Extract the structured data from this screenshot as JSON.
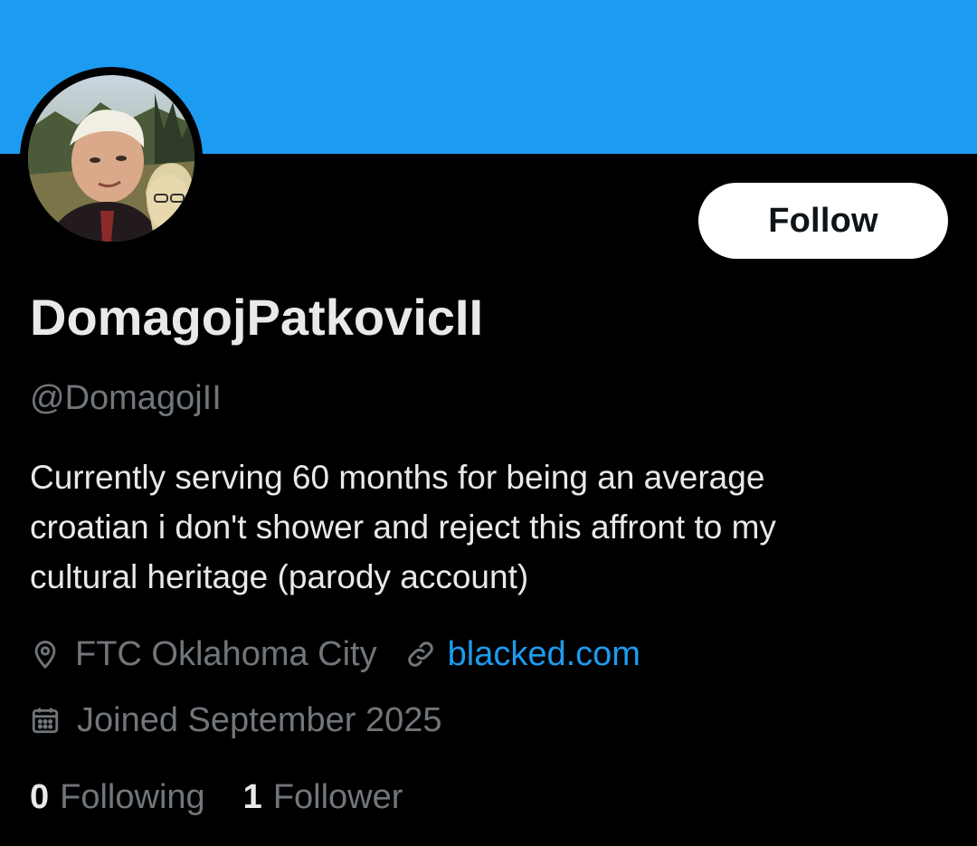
{
  "profile": {
    "banner_color": "#1d9bf0",
    "avatar_alt": "profile photo",
    "follow_label": "Follow",
    "display_name": "DomagojPatkovicII",
    "handle": "@DomagojII",
    "bio": "Currently serving 60 months for being an average\ncroatian  i don't shower and reject this affront to my\ncultural heritage (parody account)",
    "location": "FTC Oklahoma City",
    "website": "blacked.com",
    "joined": "Joined September 2025",
    "following_count": "0",
    "following_label": "Following",
    "followers_count": "1",
    "followers_label": "Follower"
  },
  "icons": {
    "location": "location-pin-icon",
    "link": "link-icon",
    "calendar": "calendar-icon"
  },
  "colors": {
    "background": "#000000",
    "primary_text": "#e7e9ea",
    "secondary_text": "#71767b",
    "link": "#1d9bf0",
    "button_bg": "#ffffff",
    "button_text": "#0f1419"
  }
}
